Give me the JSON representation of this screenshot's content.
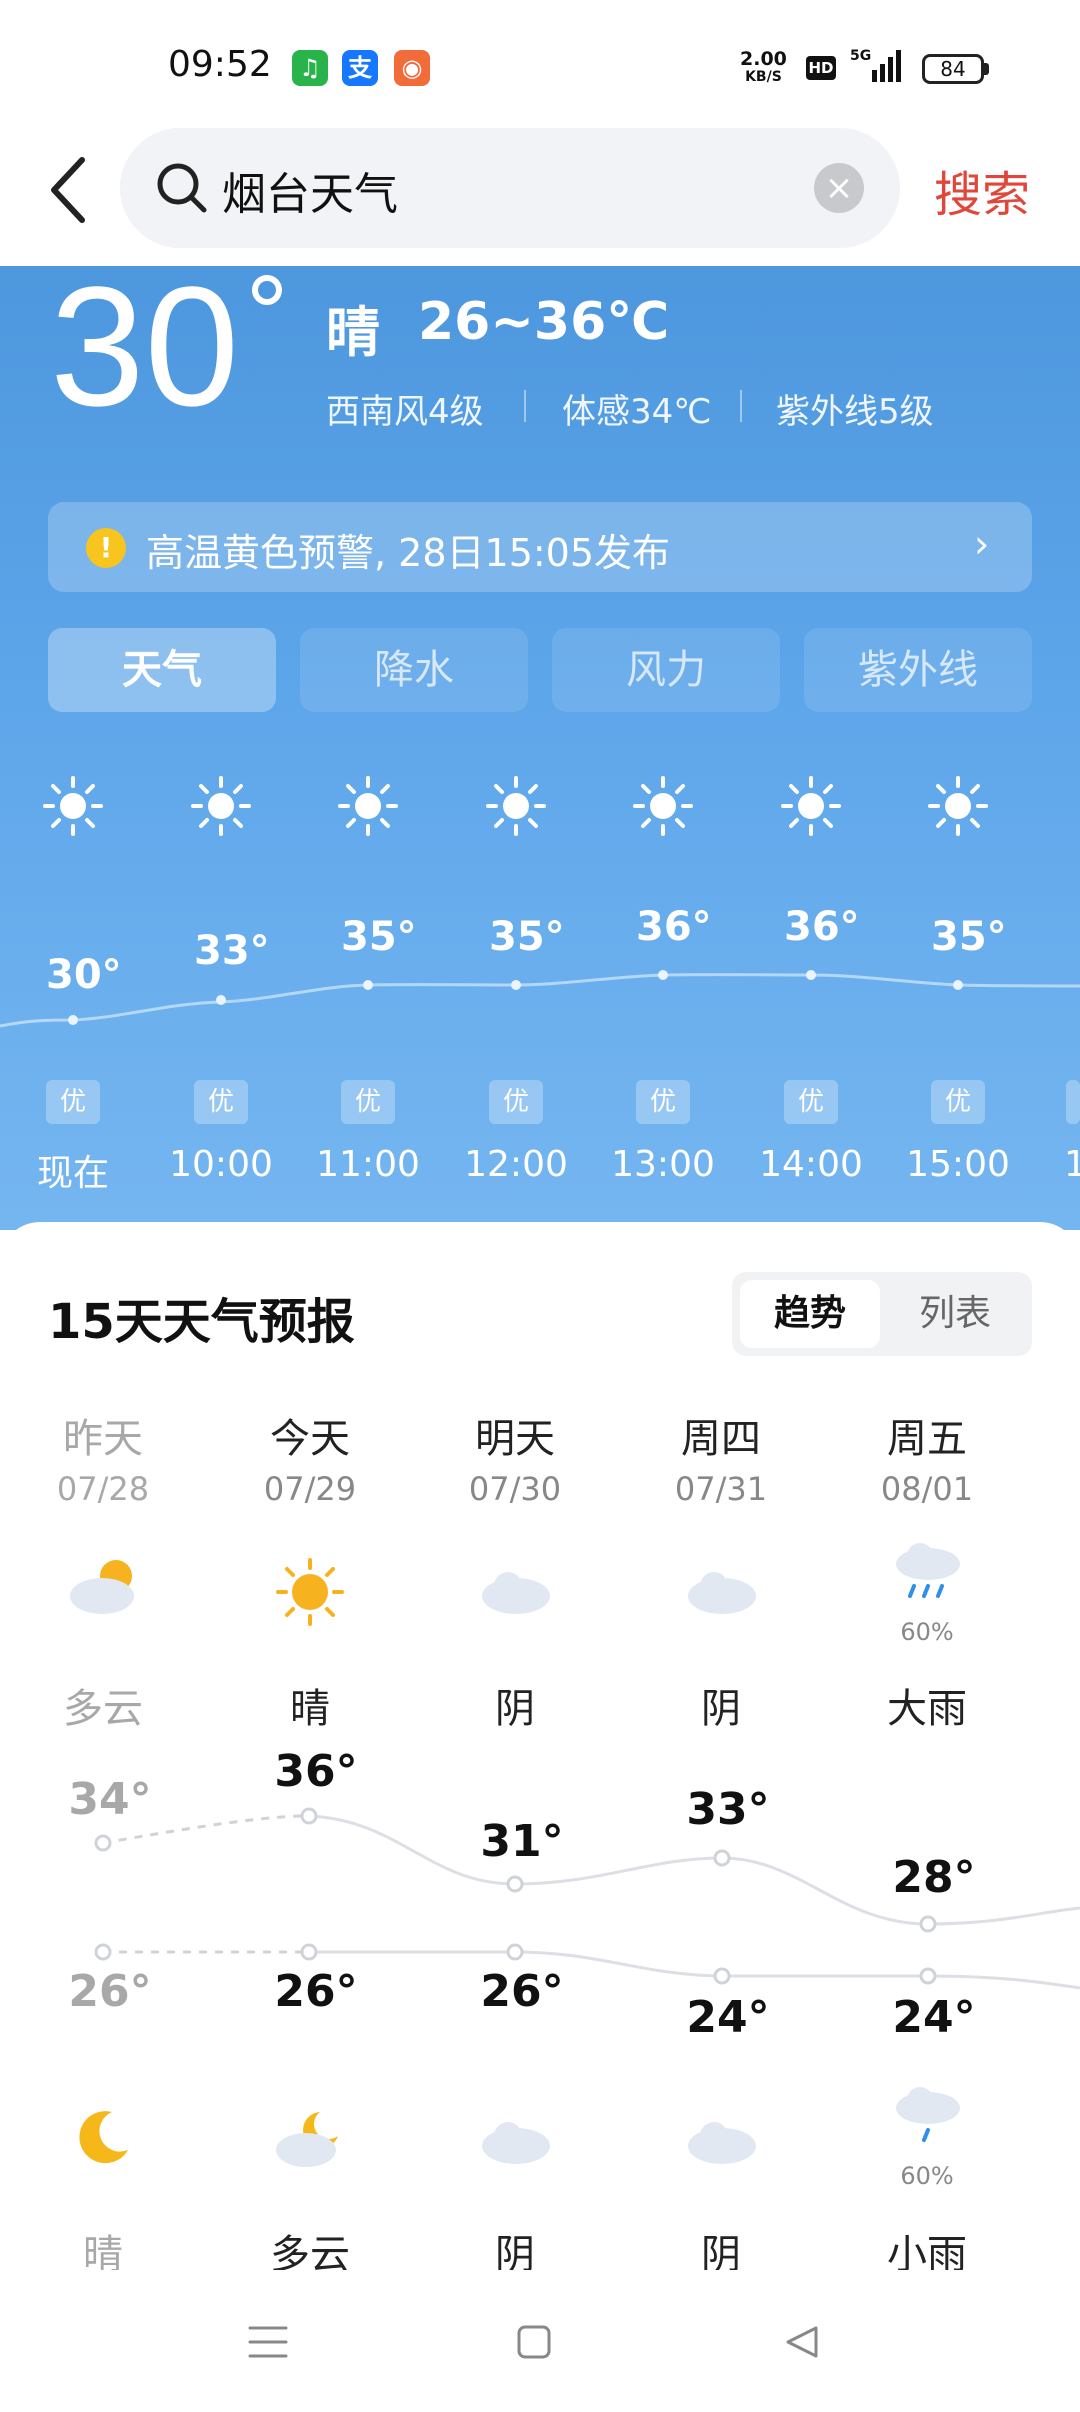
{
  "status_bar": {
    "time": "09:52",
    "app_icons": [
      {
        "name": "app-icon-green",
        "color": "#28b34b",
        "glyph": "♫"
      },
      {
        "name": "alipay-icon",
        "color": "#1677ff",
        "glyph": "支"
      },
      {
        "name": "app-icon-orange",
        "color": "#f26b3a",
        "glyph": "◉"
      }
    ],
    "net_speed": "2.00",
    "net_unit": "KB/S",
    "hd": "HD",
    "signal": "5G",
    "battery": "84"
  },
  "search": {
    "query": "烟台天气",
    "button": "搜索"
  },
  "current": {
    "temp": "30",
    "condition": "晴",
    "range": "26~36℃",
    "wind": "西南风4级",
    "feels": "体感34℃",
    "uv": "紫外线5级"
  },
  "alert": {
    "text": "高温黄色预警, 28日15:05发布",
    "icon": "!",
    "arrow": "›"
  },
  "tabs": [
    "天气",
    "降水",
    "风力",
    "紫外线"
  ],
  "hourly": [
    {
      "time": "现在",
      "temp": "30°",
      "aqi": "优"
    },
    {
      "time": "10:00",
      "temp": "33°",
      "aqi": "优"
    },
    {
      "time": "11:00",
      "temp": "35°",
      "aqi": "优"
    },
    {
      "time": "12:00",
      "temp": "35°",
      "aqi": "优"
    },
    {
      "time": "13:00",
      "temp": "36°",
      "aqi": "优"
    },
    {
      "time": "14:00",
      "temp": "36°",
      "aqi": "优"
    },
    {
      "time": "15:00",
      "temp": "35°",
      "aqi": "优"
    },
    {
      "time": "1",
      "temp": "",
      "aqi": ""
    }
  ],
  "forecast": {
    "title": "15天天气预报",
    "toggle_on": "趋势",
    "toggle_off": "列表",
    "days": [
      {
        "name": "昨天",
        "date": "07/28",
        "day_icon": "partly-cloudy-day-icon",
        "day_cond": "多云",
        "high": "34°",
        "low": "26°",
        "night_icon": "moon-icon",
        "night_cond": "晴"
      },
      {
        "name": "今天",
        "date": "07/29",
        "day_icon": "sun-icon",
        "day_cond": "晴",
        "high": "36°",
        "low": "26°",
        "night_icon": "partly-cloudy-night-icon",
        "night_cond": "多云"
      },
      {
        "name": "明天",
        "date": "07/30",
        "day_icon": "cloud-icon",
        "day_cond": "阴",
        "high": "31°",
        "low": "26°",
        "night_icon": "cloud-icon",
        "night_cond": "阴"
      },
      {
        "name": "周四",
        "date": "07/31",
        "day_icon": "cloud-icon",
        "day_cond": "阴",
        "high": "33°",
        "low": "24°",
        "night_icon": "cloud-icon",
        "night_cond": "阴"
      },
      {
        "name": "周五",
        "date": "08/01",
        "day_icon": "heavy-rain-icon",
        "day_pct": "60%",
        "day_cond": "大雨",
        "high": "28°",
        "low": "24°",
        "night_icon": "light-rain-icon",
        "night_pct": "60%",
        "night_cond": "小雨"
      }
    ]
  }
}
